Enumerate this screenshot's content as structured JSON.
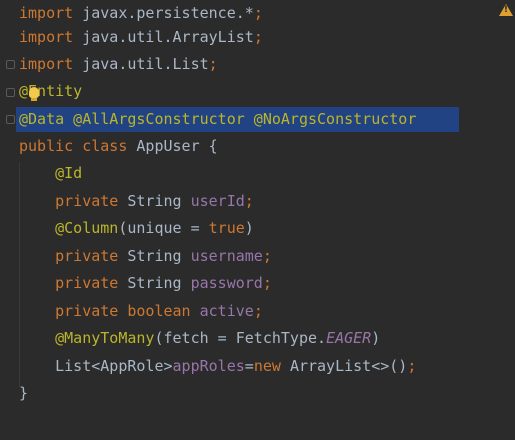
{
  "lines": [
    {
      "tokens": [
        {
          "t": "import",
          "c": "kw"
        },
        {
          "t": " javax.persistence.*",
          "c": "id"
        },
        {
          "t": ";",
          "c": "kw"
        }
      ]
    },
    {
      "tokens": [
        {
          "t": "import",
          "c": "kw"
        },
        {
          "t": " java.util.ArrayList",
          "c": "id"
        },
        {
          "t": ";",
          "c": "kw"
        }
      ]
    },
    {
      "tokens": [
        {
          "t": "import",
          "c": "kw"
        },
        {
          "t": " java.util.List",
          "c": "id"
        },
        {
          "t": ";",
          "c": "kw"
        }
      ]
    },
    {
      "tokens": [
        {
          "t": "@Entity",
          "c": "ann"
        }
      ]
    },
    {
      "tokens": [
        {
          "t": "@Data @AllArgsConstructor @NoArgsConstructor",
          "c": "ann"
        }
      ]
    },
    {
      "tokens": [
        {
          "t": "public class ",
          "c": "kw"
        },
        {
          "t": "AppUser {",
          "c": "id"
        }
      ]
    },
    {
      "tokens": [
        {
          "t": "    @Id",
          "c": "ann"
        }
      ]
    },
    {
      "tokens": [
        {
          "t": "    private ",
          "c": "kw"
        },
        {
          "t": "String ",
          "c": "id"
        },
        {
          "t": "userId",
          "c": "fld"
        },
        {
          "t": ";",
          "c": "kw"
        }
      ]
    },
    {
      "tokens": [
        {
          "t": "    @Column",
          "c": "ann"
        },
        {
          "t": "(unique = ",
          "c": "id"
        },
        {
          "t": "true",
          "c": "kw"
        },
        {
          "t": ")",
          "c": "id"
        }
      ]
    },
    {
      "tokens": [
        {
          "t": "    private ",
          "c": "kw"
        },
        {
          "t": "String ",
          "c": "id"
        },
        {
          "t": "username",
          "c": "fld"
        },
        {
          "t": ";",
          "c": "kw"
        }
      ]
    },
    {
      "tokens": [
        {
          "t": "    private ",
          "c": "kw"
        },
        {
          "t": "String ",
          "c": "id"
        },
        {
          "t": "password",
          "c": "fld"
        },
        {
          "t": ";",
          "c": "kw"
        }
      ]
    },
    {
      "tokens": [
        {
          "t": "    private boolean ",
          "c": "kw"
        },
        {
          "t": "active",
          "c": "fld"
        },
        {
          "t": ";",
          "c": "kw"
        }
      ]
    },
    {
      "tokens": [
        {
          "t": "    @ManyToMany",
          "c": "ann"
        },
        {
          "t": "(fetch = FetchType.",
          "c": "id"
        },
        {
          "t": "EAGER",
          "c": "fld it"
        },
        {
          "t": ")",
          "c": "id"
        }
      ]
    },
    {
      "tokens": [
        {
          "t": "    List<AppRole>",
          "c": "id"
        },
        {
          "t": "appRoles",
          "c": "fld"
        },
        {
          "t": "=",
          "c": "id"
        },
        {
          "t": "new ",
          "c": "kw"
        },
        {
          "t": "ArrayList<>()",
          "c": "id"
        },
        {
          "t": ";",
          "c": "kw"
        }
      ]
    },
    {
      "tokens": [
        {
          "t": "}",
          "c": "id"
        }
      ]
    }
  ],
  "colors": {
    "background": "#2b2b2b",
    "keyword": "#cc7832",
    "annotation": "#bbb529",
    "field": "#9876aa",
    "text": "#a9b7c6",
    "selection": "#214283",
    "warning": "#e0a030"
  },
  "icons": {
    "warning": "warning-icon",
    "bulb": "intention-bulb-icon",
    "fold": "fold-marker-icon"
  }
}
